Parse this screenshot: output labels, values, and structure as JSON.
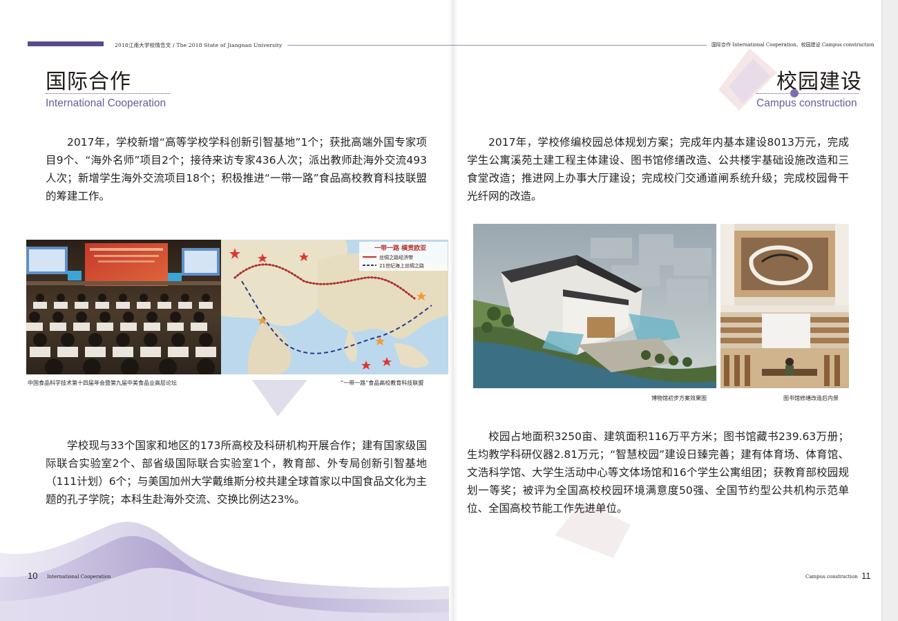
{
  "header": {
    "left_text": "2018江南大学校情告文 / The 2018 State of Jiangnan University",
    "right_text": "国际合作 International Cooperation、校园建设 Campus construction"
  },
  "left": {
    "title_cn": "国际合作",
    "title_en": "International Cooperation",
    "para1": "2017年，学校新增“高等学校学科创新引智基地”1个；获批高端外国专家项目9个、“海外名师”项目2个；接待来访专家436人次；派出教师赴海外交流493人次；新增学生海外交流项目18个；积极推进“一带一路”食品高校教育科技联盟的筹建工作。",
    "caption1": "中国食品科学技术第十四届年会暨第九届中美食品业高层论坛",
    "caption2": "“一带一路”食品高校教育科技联盟",
    "map_legend_title": "一带一路 横贯欧亚",
    "map_legend_line1": "丝绸之路经济带",
    "map_legend_line2": "21世纪海上丝绸之路",
    "para2": "学校现与33个国家和地区的173所高校及科研机构开展合作；建有国家级国际联合实验室2个、部省级国际联合实验室1个，教育部、外专局创新引智基地（111计划）6个；与美国加州大学戴维斯分校共建全球首家以中国食品文化为主题的孔子学院；本科生赴海外交流、交换比例达23%。",
    "page_number": "10",
    "footer_en": "International Cooperation"
  },
  "right": {
    "title_cn": "校园建设",
    "title_en": "Campus construction",
    "para1": "2017年，学校修编校园总体规划方案；完成年内基本建设8013万元，完成学生公寓溪苑土建工程主体建设、图书馆修缮改造、公共楼宇基础设施改造和三食堂改造；推进网上办事大厅建设；完成校门交通道闸系统升级；完成校园骨干光纤网的改造。",
    "caption1": "博物馆初步方案效果图",
    "caption2": "图书馆修缮改造后内景",
    "para2": "校园占地面积3250亩、建筑面积116万平方米；图书馆藏书239.63万册；生均教学科研仪器2.81万元；“智慧校园”建设日臻完善；建有体育场、体育馆、文浩科学馆、大学生活动中心等文体场馆和16个学生公寓组团；获教育部校园规划一等奖；被评为全国高校校园环境满意度50强、全国节约型公共机构示范单位、全国高校节能工作先进单位。",
    "page_number": "11",
    "footer_en": "Campus construction"
  },
  "colors": {
    "accent": "#5a4a8e",
    "title_en": "#6a5a9e",
    "text": "#231f20"
  }
}
